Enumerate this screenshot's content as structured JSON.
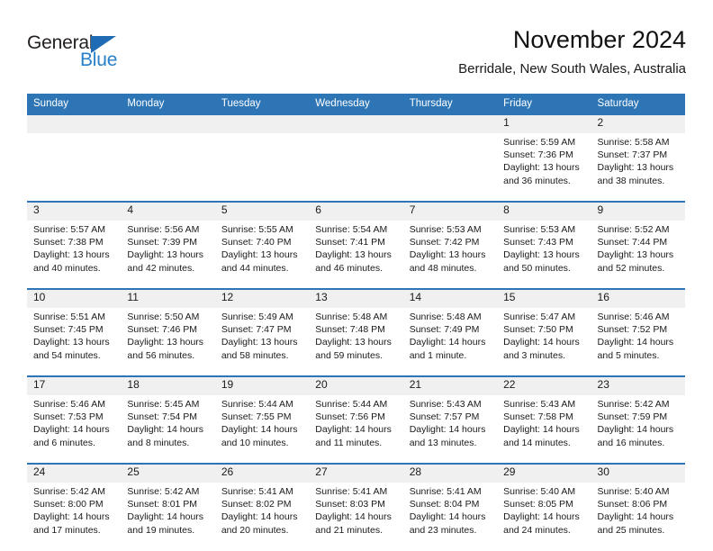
{
  "logo": {
    "word_one": "General",
    "word_two": "Blue",
    "triangle_color": "#1f6cb4",
    "word_two_color": "#2880c8",
    "word_one_color": "#231f20"
  },
  "header": {
    "title": "November 2024",
    "subtitle": "Berridale, New South Wales, Australia"
  },
  "theme": {
    "header_blue": "#2e75b6",
    "daynum_band": "#f0f0f0",
    "cell_background": "#ffffff",
    "text": "#1a1a1a"
  },
  "weekday_headers": [
    "Sunday",
    "Monday",
    "Tuesday",
    "Wednesday",
    "Thursday",
    "Friday",
    "Saturday"
  ],
  "weeks": [
    {
      "days": [
        {
          "num": "",
          "sunrise": "",
          "sunset": "",
          "daylight_1": "",
          "daylight_2": ""
        },
        {
          "num": "",
          "sunrise": "",
          "sunset": "",
          "daylight_1": "",
          "daylight_2": ""
        },
        {
          "num": "",
          "sunrise": "",
          "sunset": "",
          "daylight_1": "",
          "daylight_2": ""
        },
        {
          "num": "",
          "sunrise": "",
          "sunset": "",
          "daylight_1": "",
          "daylight_2": ""
        },
        {
          "num": "",
          "sunrise": "",
          "sunset": "",
          "daylight_1": "",
          "daylight_2": ""
        },
        {
          "num": "1",
          "sunrise": "Sunrise: 5:59 AM",
          "sunset": "Sunset: 7:36 PM",
          "daylight_1": "Daylight: 13 hours",
          "daylight_2": "and 36 minutes."
        },
        {
          "num": "2",
          "sunrise": "Sunrise: 5:58 AM",
          "sunset": "Sunset: 7:37 PM",
          "daylight_1": "Daylight: 13 hours",
          "daylight_2": "and 38 minutes."
        }
      ]
    },
    {
      "days": [
        {
          "num": "3",
          "sunrise": "Sunrise: 5:57 AM",
          "sunset": "Sunset: 7:38 PM",
          "daylight_1": "Daylight: 13 hours",
          "daylight_2": "and 40 minutes."
        },
        {
          "num": "4",
          "sunrise": "Sunrise: 5:56 AM",
          "sunset": "Sunset: 7:39 PM",
          "daylight_1": "Daylight: 13 hours",
          "daylight_2": "and 42 minutes."
        },
        {
          "num": "5",
          "sunrise": "Sunrise: 5:55 AM",
          "sunset": "Sunset: 7:40 PM",
          "daylight_1": "Daylight: 13 hours",
          "daylight_2": "and 44 minutes."
        },
        {
          "num": "6",
          "sunrise": "Sunrise: 5:54 AM",
          "sunset": "Sunset: 7:41 PM",
          "daylight_1": "Daylight: 13 hours",
          "daylight_2": "and 46 minutes."
        },
        {
          "num": "7",
          "sunrise": "Sunrise: 5:53 AM",
          "sunset": "Sunset: 7:42 PM",
          "daylight_1": "Daylight: 13 hours",
          "daylight_2": "and 48 minutes."
        },
        {
          "num": "8",
          "sunrise": "Sunrise: 5:53 AM",
          "sunset": "Sunset: 7:43 PM",
          "daylight_1": "Daylight: 13 hours",
          "daylight_2": "and 50 minutes."
        },
        {
          "num": "9",
          "sunrise": "Sunrise: 5:52 AM",
          "sunset": "Sunset: 7:44 PM",
          "daylight_1": "Daylight: 13 hours",
          "daylight_2": "and 52 minutes."
        }
      ]
    },
    {
      "days": [
        {
          "num": "10",
          "sunrise": "Sunrise: 5:51 AM",
          "sunset": "Sunset: 7:45 PM",
          "daylight_1": "Daylight: 13 hours",
          "daylight_2": "and 54 minutes."
        },
        {
          "num": "11",
          "sunrise": "Sunrise: 5:50 AM",
          "sunset": "Sunset: 7:46 PM",
          "daylight_1": "Daylight: 13 hours",
          "daylight_2": "and 56 minutes."
        },
        {
          "num": "12",
          "sunrise": "Sunrise: 5:49 AM",
          "sunset": "Sunset: 7:47 PM",
          "daylight_1": "Daylight: 13 hours",
          "daylight_2": "and 58 minutes."
        },
        {
          "num": "13",
          "sunrise": "Sunrise: 5:48 AM",
          "sunset": "Sunset: 7:48 PM",
          "daylight_1": "Daylight: 13 hours",
          "daylight_2": "and 59 minutes."
        },
        {
          "num": "14",
          "sunrise": "Sunrise: 5:48 AM",
          "sunset": "Sunset: 7:49 PM",
          "daylight_1": "Daylight: 14 hours",
          "daylight_2": "and 1 minute."
        },
        {
          "num": "15",
          "sunrise": "Sunrise: 5:47 AM",
          "sunset": "Sunset: 7:50 PM",
          "daylight_1": "Daylight: 14 hours",
          "daylight_2": "and 3 minutes."
        },
        {
          "num": "16",
          "sunrise": "Sunrise: 5:46 AM",
          "sunset": "Sunset: 7:52 PM",
          "daylight_1": "Daylight: 14 hours",
          "daylight_2": "and 5 minutes."
        }
      ]
    },
    {
      "days": [
        {
          "num": "17",
          "sunrise": "Sunrise: 5:46 AM",
          "sunset": "Sunset: 7:53 PM",
          "daylight_1": "Daylight: 14 hours",
          "daylight_2": "and 6 minutes."
        },
        {
          "num": "18",
          "sunrise": "Sunrise: 5:45 AM",
          "sunset": "Sunset: 7:54 PM",
          "daylight_1": "Daylight: 14 hours",
          "daylight_2": "and 8 minutes."
        },
        {
          "num": "19",
          "sunrise": "Sunrise: 5:44 AM",
          "sunset": "Sunset: 7:55 PM",
          "daylight_1": "Daylight: 14 hours",
          "daylight_2": "and 10 minutes."
        },
        {
          "num": "20",
          "sunrise": "Sunrise: 5:44 AM",
          "sunset": "Sunset: 7:56 PM",
          "daylight_1": "Daylight: 14 hours",
          "daylight_2": "and 11 minutes."
        },
        {
          "num": "21",
          "sunrise": "Sunrise: 5:43 AM",
          "sunset": "Sunset: 7:57 PM",
          "daylight_1": "Daylight: 14 hours",
          "daylight_2": "and 13 minutes."
        },
        {
          "num": "22",
          "sunrise": "Sunrise: 5:43 AM",
          "sunset": "Sunset: 7:58 PM",
          "daylight_1": "Daylight: 14 hours",
          "daylight_2": "and 14 minutes."
        },
        {
          "num": "23",
          "sunrise": "Sunrise: 5:42 AM",
          "sunset": "Sunset: 7:59 PM",
          "daylight_1": "Daylight: 14 hours",
          "daylight_2": "and 16 minutes."
        }
      ]
    },
    {
      "days": [
        {
          "num": "24",
          "sunrise": "Sunrise: 5:42 AM",
          "sunset": "Sunset: 8:00 PM",
          "daylight_1": "Daylight: 14 hours",
          "daylight_2": "and 17 minutes."
        },
        {
          "num": "25",
          "sunrise": "Sunrise: 5:42 AM",
          "sunset": "Sunset: 8:01 PM",
          "daylight_1": "Daylight: 14 hours",
          "daylight_2": "and 19 minutes."
        },
        {
          "num": "26",
          "sunrise": "Sunrise: 5:41 AM",
          "sunset": "Sunset: 8:02 PM",
          "daylight_1": "Daylight: 14 hours",
          "daylight_2": "and 20 minutes."
        },
        {
          "num": "27",
          "sunrise": "Sunrise: 5:41 AM",
          "sunset": "Sunset: 8:03 PM",
          "daylight_1": "Daylight: 14 hours",
          "daylight_2": "and 21 minutes."
        },
        {
          "num": "28",
          "sunrise": "Sunrise: 5:41 AM",
          "sunset": "Sunset: 8:04 PM",
          "daylight_1": "Daylight: 14 hours",
          "daylight_2": "and 23 minutes."
        },
        {
          "num": "29",
          "sunrise": "Sunrise: 5:40 AM",
          "sunset": "Sunset: 8:05 PM",
          "daylight_1": "Daylight: 14 hours",
          "daylight_2": "and 24 minutes."
        },
        {
          "num": "30",
          "sunrise": "Sunrise: 5:40 AM",
          "sunset": "Sunset: 8:06 PM",
          "daylight_1": "Daylight: 14 hours",
          "daylight_2": "and 25 minutes."
        }
      ]
    }
  ]
}
